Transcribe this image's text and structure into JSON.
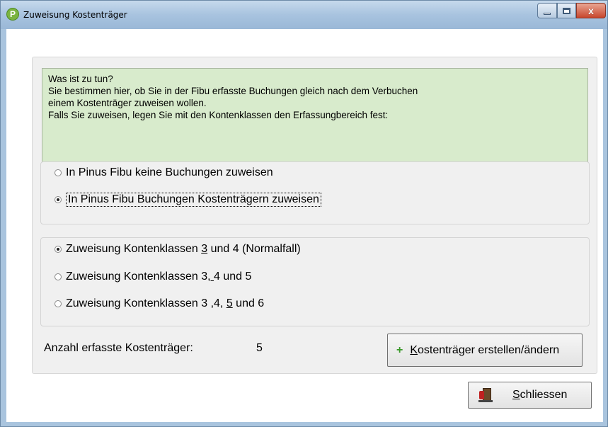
{
  "window": {
    "title": "Zuweisung Kostenträger",
    "close_symbol": "x"
  },
  "info": {
    "lines": [
      "Was ist zu tun?",
      "Sie bestimmen hier, ob Sie  in der Fibu erfasste Buchungen gleich nach dem Verbuchen",
      "einem Kostenträger zuweisen wollen.",
      "Falls Sie zuweisen, legen Sie mit den Kontenklassen den Erfassungbereich fest:"
    ]
  },
  "mode_options": [
    {
      "label": "In Pinus Fibu keine Buchungen zuweisen",
      "checked": false
    },
    {
      "label": "In Pinus Fibu Buchungen Kostenträgern zuweisen",
      "checked": true
    }
  ],
  "class_options": [
    {
      "pre": "Zuweisung Kontenklassen ",
      "accel": "3",
      "post": " und 4 (Normalfall)",
      "checked": true
    },
    {
      "pre": "Zuweisung Kontenklassen 3,",
      "accel": " ",
      "post": "4 und 5",
      "checked": false
    },
    {
      "pre": "Zuweisung Kontenklassen 3 ,4, ",
      "accel": "5",
      "post": " und 6",
      "checked": false
    }
  ],
  "count": {
    "label": "Anzahl erfasste Kostenträger:",
    "value": "5"
  },
  "buttons": {
    "kost_accel": "K",
    "kost_rest": "ostenträger erstellen/ändern",
    "close_accel": "S",
    "close_rest": "chliessen"
  },
  "icons": {
    "app": "pinus-app-icon",
    "plus": "plus-icon",
    "exit": "exit-door-icon"
  },
  "colors": {
    "info_bg": "#d8ebcc",
    "plus": "#3a9a2a"
  }
}
